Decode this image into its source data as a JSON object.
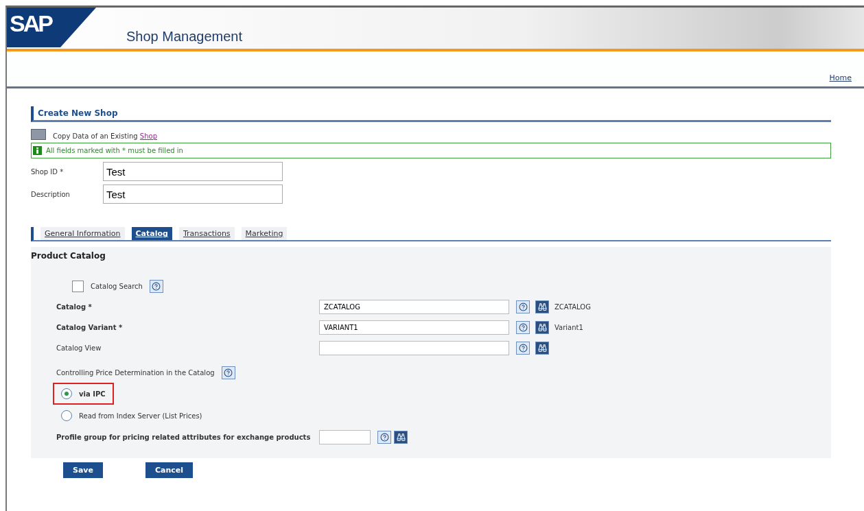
{
  "header": {
    "logo": "SAP",
    "title": "Shop Management",
    "nav_link": "Home"
  },
  "page": {
    "title": "Create New Shop",
    "copy_text": "Copy Data of an Existing ",
    "copy_link": "Shop",
    "info": "All fields marked with * must be filled in"
  },
  "fields": [
    {
      "label": "Shop ID *",
      "value": "Test"
    },
    {
      "label": "Description",
      "value": "Test"
    }
  ],
  "tabs": [
    {
      "label": "General Information",
      "selected": false
    },
    {
      "label": "Catalog",
      "selected": true
    },
    {
      "label": "Transactions",
      "selected": false
    },
    {
      "label": "Marketing",
      "selected": false
    }
  ],
  "section": {
    "title": "Product Catalog",
    "catalog_search": {
      "label": "Catalog Search",
      "checked": false
    },
    "rows": [
      {
        "label": "Catalog *",
        "kind": "required",
        "value": "ZCATALOG",
        "description": "ZCATALOG"
      },
      {
        "label": "Catalog Variant *",
        "kind": "required",
        "value": "VARIANT1",
        "description": "Variant1"
      },
      {
        "label": "Catalog View",
        "kind": "optional",
        "value": ""
      }
    ],
    "price_label": "Controlling Price Determination in the Catalog",
    "price_options": [
      {
        "label": "via IPC",
        "selected": true,
        "kind": "framed"
      },
      {
        "label": "Read from Index Server (List Prices)",
        "selected": false,
        "kind": "plain"
      }
    ],
    "profile_label": "Profile group for pricing related attributes for exchange products"
  },
  "buttons": [
    "Save",
    "Cancel"
  ]
}
